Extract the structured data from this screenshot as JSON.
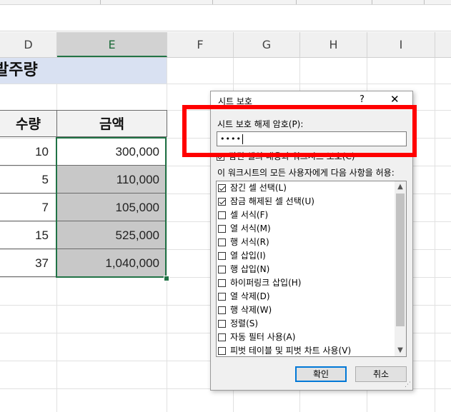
{
  "columns": [
    "D",
    "E",
    "F",
    "G",
    "H",
    "I"
  ],
  "sheet": {
    "title": "발주량",
    "headers": {
      "qty": "수량",
      "amount": "금액"
    },
    "rows": [
      {
        "qty": "10",
        "amount": "300,000"
      },
      {
        "qty": "5",
        "amount": "110,000"
      },
      {
        "qty": "7",
        "amount": "105,000"
      },
      {
        "qty": "15",
        "amount": "525,000"
      },
      {
        "qty": "37",
        "amount": "1,040,000"
      }
    ]
  },
  "dialog": {
    "title": "시트 보호",
    "help": "?",
    "close": "✕",
    "password_label": "시트 보호 해제 암호(P):",
    "password_value": "••••",
    "protect_label": "잠긴 셀의 내용과 워크시트 보호(C)",
    "allow_label": "이 워크시트의 모든 사용자에게 다음 사항을 허용:",
    "options": [
      {
        "label": "잠긴 셀 선택(L)",
        "checked": true
      },
      {
        "label": "잠금 해제된 셀 선택(U)",
        "checked": true
      },
      {
        "label": "셀 서식(F)",
        "checked": false
      },
      {
        "label": "열 서식(M)",
        "checked": false
      },
      {
        "label": "행 서식(R)",
        "checked": false
      },
      {
        "label": "열 삽입(I)",
        "checked": false
      },
      {
        "label": "행 삽입(N)",
        "checked": false
      },
      {
        "label": "하이퍼링크 삽입(H)",
        "checked": false
      },
      {
        "label": "열 삭제(D)",
        "checked": false
      },
      {
        "label": "행 삭제(W)",
        "checked": false
      },
      {
        "label": "정렬(S)",
        "checked": false
      },
      {
        "label": "자동 필터 사용(A)",
        "checked": false
      },
      {
        "label": "피벗 테이블 및 피벗 차트 사용(V)",
        "checked": false
      }
    ],
    "ok_label": "확인",
    "cancel_label": "취소"
  },
  "colors": {
    "accent": "#217346",
    "highlight": "#ff0000",
    "title_fill": "#d9e1f2",
    "gray_fill": "#c8c8c8"
  }
}
